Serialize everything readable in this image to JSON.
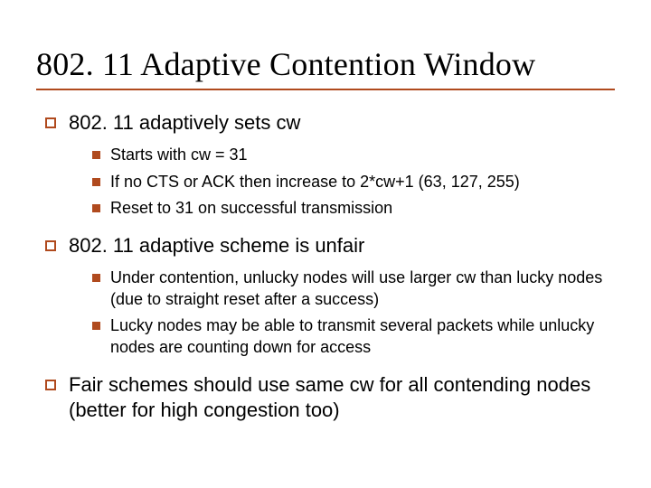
{
  "title": "802. 11 Adaptive Contention Window",
  "bullets": [
    {
      "text": "802. 11 adaptively sets cw",
      "sub": [
        "Starts with cw = 31",
        "If no CTS or ACK then increase to 2*cw+1 (63, 127, 255)",
        "Reset to 31 on successful transmission"
      ]
    },
    {
      "text": "802. 11 adaptive scheme is unfair",
      "sub": [
        "Under contention, unlucky nodes will use larger cw than lucky nodes (due to straight reset after a success)",
        "Lucky nodes may be able to transmit several packets while unlucky nodes are counting down for access"
      ]
    },
    {
      "text": "Fair schemes should use same cw for all contending nodes (better for high congestion too)",
      "sub": []
    }
  ]
}
